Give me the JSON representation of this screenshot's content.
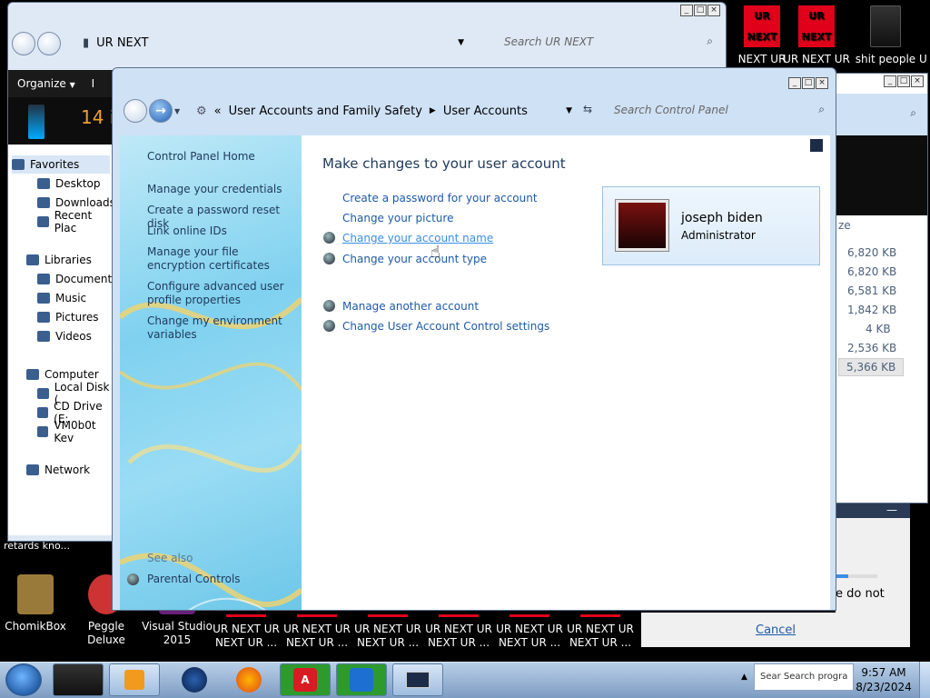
{
  "desktop": {
    "top_icons": [
      {
        "label": "NEXT UR",
        "icon_text": "UR\nNEXT",
        "icon": "ur-next-icon"
      },
      {
        "label": "UR NEXT UR",
        "icon_text": "UR\nNEXT",
        "icon": "ur-next-icon"
      },
      {
        "label": "shit people",
        "icon": "folder-icon"
      },
      {
        "label": "U",
        "icon": "partial-icon"
      }
    ],
    "bottom_icons": [
      {
        "label": "ChomikBox",
        "icon": "chomikbox-icon"
      },
      {
        "label": "Peggle Deluxe",
        "icon": "peggle-icon"
      },
      {
        "label": "Visual Studio 2015",
        "icon": "visual-studio-icon"
      }
    ],
    "ur_tiles": [
      "UR NEXT UR NEXT UR ...",
      "UR NEXT UR NEXT UR ...",
      "UR NEXT UR NEXT UR ...",
      "UR NEXT UR NEXT UR ...",
      "UR NEXT UR NEXT UR ...",
      "UR NEXT UR NEXT UR ..."
    ],
    "stray_label": "retards kno...",
    "colors": {
      "accent_red": "#e0001a",
      "link_blue": "#1e5aa8"
    }
  },
  "explorer_window": {
    "title_path": "UR NEXT",
    "search_placeholder": "Search UR NEXT",
    "organize_label": "Organize",
    "count_text": "14 i",
    "toolbar_partial": "I",
    "nav": {
      "favorites": "Favorites",
      "desktop": "Desktop",
      "downloads": "Downloads",
      "recent": "Recent Plac",
      "libraries": "Libraries",
      "documents": "Documents",
      "music": "Music",
      "pictures": "Pictures",
      "videos": "Videos",
      "computer": "Computer",
      "local_disk": "Local Disk (",
      "cd_drive": "CD Drive (E:",
      "vm": "VM0b0t Kev",
      "network": "Network"
    }
  },
  "right_window": {
    "size_header": "ze",
    "sizes": [
      "6,820 KB",
      "6,820 KB",
      "6,581 KB",
      "1,842 KB",
      "4 KB",
      "2,536 KB",
      "5,366 KB"
    ]
  },
  "dialog": {
    "minimize": "—",
    "text": "e do not",
    "cancel": "Cancel"
  },
  "control_panel": {
    "breadcrumb": [
      "User Accounts and Family Safety",
      "User Accounts"
    ],
    "search_placeholder": "Search Control Panel",
    "left_links": {
      "home": "Control Panel Home",
      "credentials": "Manage your credentials",
      "reset_disk": "Create a password reset disk",
      "online_ids": "Link online IDs",
      "encryption": "Manage your file encryption certificates",
      "profile": "Configure advanced user profile properties",
      "environment": "Change my environment variables",
      "see_also": "See also",
      "parental": "Parental Controls"
    },
    "heading": "Make changes to your user account",
    "links": {
      "create_password": "Create a password for your account",
      "change_picture": "Change your picture",
      "change_name": "Change your account name",
      "change_type": "Change your account type",
      "manage_another": "Manage another account",
      "uac": "Change User Account Control settings"
    },
    "user": {
      "name": "joseph biden",
      "role": "Administrator"
    }
  },
  "taskbar": {
    "time": "9:57 AM",
    "date": "8/23/2024",
    "tray_search": "Sear Search progra"
  }
}
